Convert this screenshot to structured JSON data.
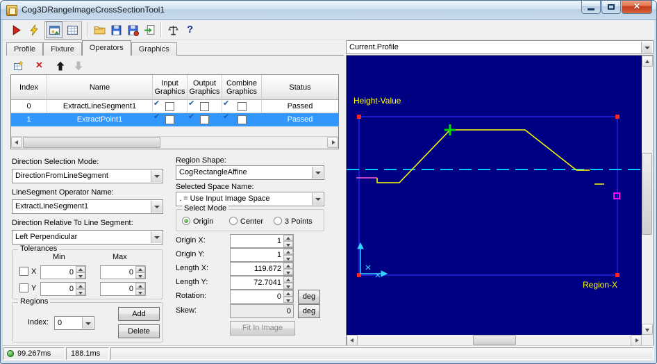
{
  "colors": {
    "selection": "#3297fd",
    "display_background": "#000083",
    "profile_line": "#ffff00",
    "region_outline": "#2d2dff",
    "marker_cross": "#00d800",
    "dashed_reference_line": "#00ccff",
    "edge_handle": "#ff00ff",
    "corner_handle": "#ff2222",
    "status_led": "#2e8f2e"
  },
  "window": {
    "title": "Cog3DRangeImageCrossSectionTool1"
  },
  "toolbar": {
    "icons": [
      "run-tool",
      "run-tool-electric",
      "display-image-toggle",
      "display-grid-toggle",
      "open-file",
      "save",
      "save-image",
      "import-image",
      "balance-units",
      "help"
    ]
  },
  "tabs": [
    {
      "label": "Profile",
      "active": false
    },
    {
      "label": "Fixture",
      "active": false
    },
    {
      "label": "Operators",
      "active": true
    },
    {
      "label": "Graphics",
      "active": false
    }
  ],
  "operators": {
    "toolbar_icons": [
      "add-operator",
      "delete-operator",
      "move-operator-up",
      "move-operator-down"
    ],
    "table": {
      "headers": {
        "index": "Index",
        "name": "Name",
        "input": "Input\nGraphics",
        "output": "Output\nGraphics",
        "combine": "Combine\nGraphics",
        "status": "Status"
      },
      "rows": [
        {
          "index": "0",
          "name": "ExtractLineSegment1",
          "input": true,
          "output": true,
          "combine": true,
          "status": "Passed",
          "selected": false
        },
        {
          "index": "1",
          "name": "ExtractPoint1",
          "input": true,
          "output": true,
          "combine": true,
          "status": "Passed",
          "selected": true
        }
      ]
    },
    "direction_selection_mode": {
      "label": "Direction Selection Mode:",
      "value": "DirectionFromLineSegment"
    },
    "linesegment_operator_name": {
      "label": "LineSegment Operator Name:",
      "value": "ExtractLineSegment1"
    },
    "direction_relative": {
      "label": "Direction Relative To Line Segment:",
      "value": "Left Perpendicular"
    },
    "tolerances": {
      "title": "Tolerances",
      "min_header": "Min",
      "max_header": "Max",
      "rows": [
        {
          "label": "X",
          "checked": false,
          "min": "0",
          "max": "0"
        },
        {
          "label": "Y",
          "checked": false,
          "min": "0",
          "max": "0"
        }
      ]
    },
    "regions": {
      "title": "Regions",
      "index_label": "Index:",
      "index_value": "0",
      "add_label": "Add",
      "delete_label": "Delete"
    },
    "region_shape": {
      "label": "Region Shape:",
      "value": "CogRectangleAffine"
    },
    "selected_space": {
      "label": "Selected Space Name:",
      "value": ". = Use Input Image Space"
    },
    "select_mode": {
      "title": "Select Mode",
      "options": [
        {
          "label": "Origin",
          "selected": true
        },
        {
          "label": "Center",
          "selected": false
        },
        {
          "label": "3 Points",
          "selected": false
        }
      ]
    },
    "fields": {
      "origin_x": {
        "label": "Origin X:",
        "value": "1"
      },
      "origin_y": {
        "label": "Origin Y:",
        "value": "1"
      },
      "length_x": {
        "label": "Length X:",
        "value": "119.672"
      },
      "length_y": {
        "label": "Length Y:",
        "value": "72.7041"
      },
      "rotation": {
        "label": "Rotation:",
        "value": "0",
        "unit": "deg"
      },
      "skew": {
        "label": "Skew:",
        "value": "0",
        "unit": "deg"
      }
    },
    "fit_in_image_label": "Fit In Image"
  },
  "display": {
    "source_selector": "Current.Profile",
    "y_axis_label": "Height-Value",
    "x_axis_label": "Region-X"
  },
  "status_bar": {
    "tool_time": "99.267ms",
    "total_time": "188.1ms"
  }
}
